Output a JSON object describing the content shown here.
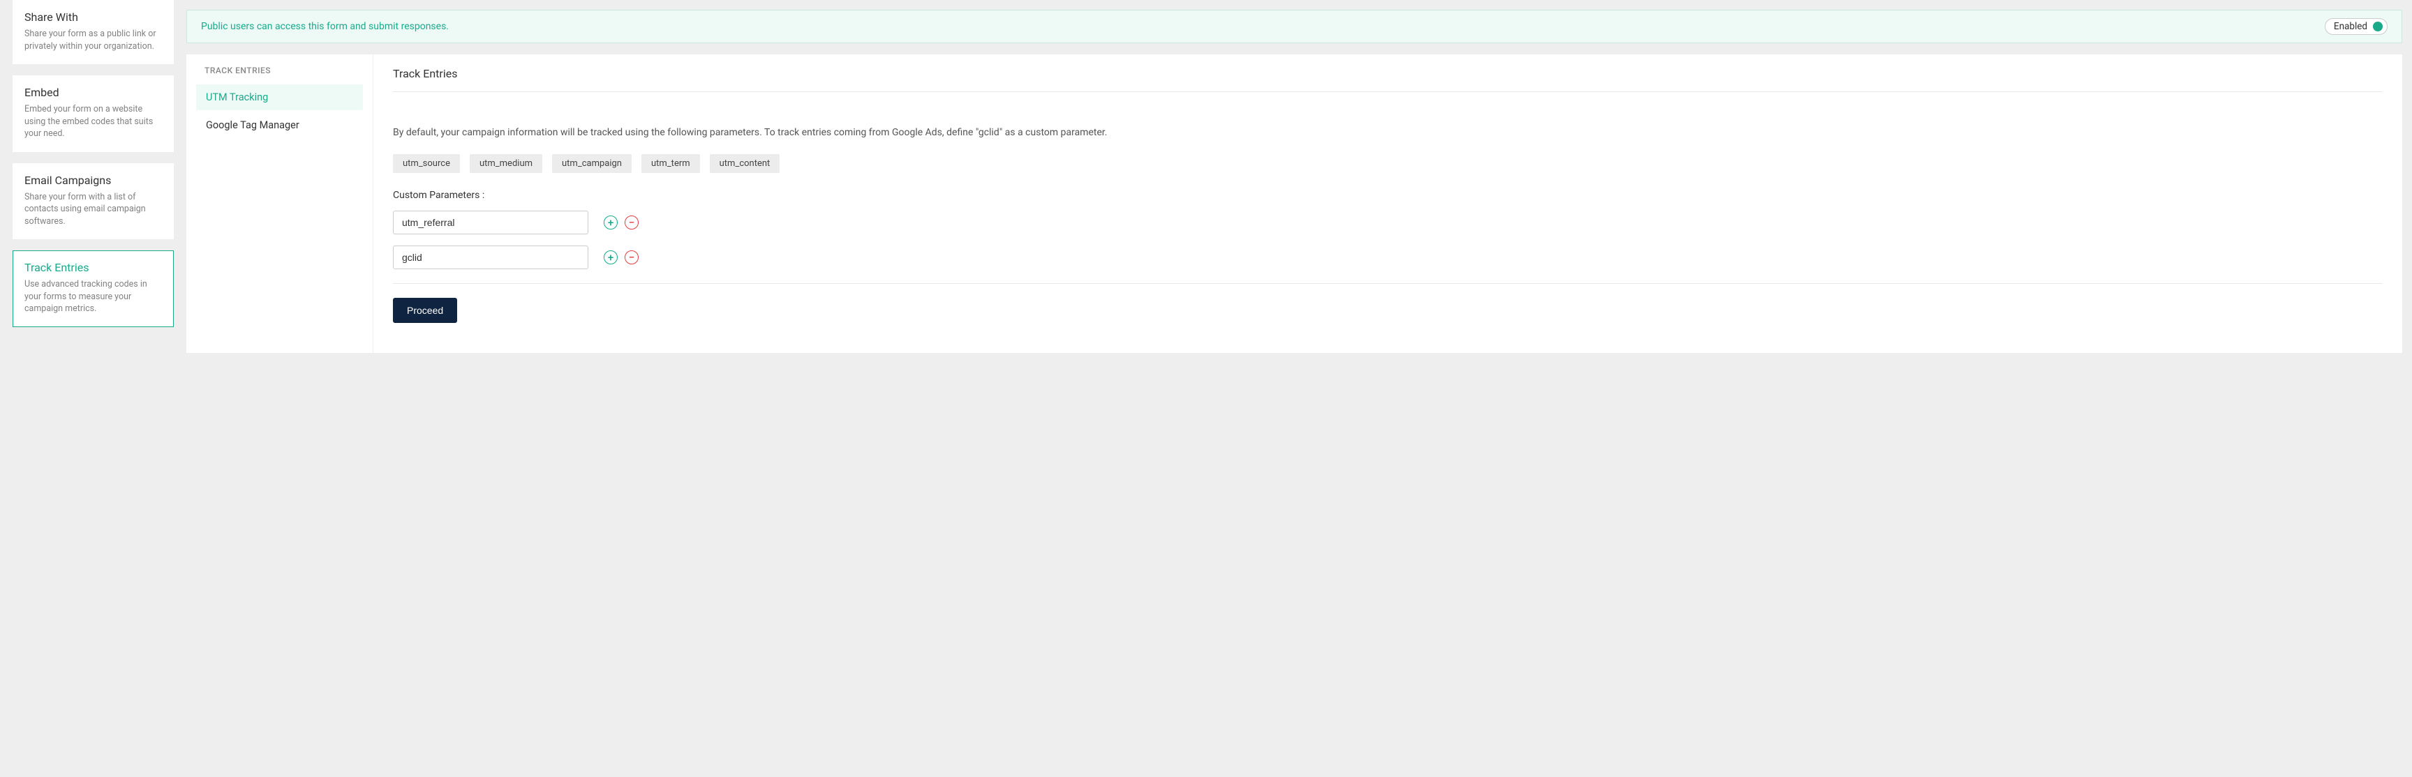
{
  "sidebar": {
    "items": [
      {
        "title": "Share With",
        "desc": "Share your form as a public link or privately within your organization.",
        "active": false
      },
      {
        "title": "Embed",
        "desc": "Embed your form on a website using the embed codes that suits your need.",
        "active": false
      },
      {
        "title": "Email Campaigns",
        "desc": "Share your form with a list of contacts using email campaign softwares.",
        "active": false
      },
      {
        "title": "Track Entries",
        "desc": "Use advanced tracking codes in your forms to measure your campaign metrics.",
        "active": true
      }
    ]
  },
  "banner": {
    "text": "Public users can access this form and submit responses.",
    "toggle_label": "Enabled"
  },
  "inner_sidebar": {
    "header": "TRACK ENTRIES",
    "items": [
      {
        "label": "UTM Tracking",
        "active": true
      },
      {
        "label": "Google Tag Manager",
        "active": false
      }
    ]
  },
  "content": {
    "title": "Track Entries",
    "desc": "By default, your campaign information will be tracked using the following parameters. To track entries coming from Google Ads, define \"gclid\" as a custom parameter.",
    "tags": [
      "utm_source",
      "utm_medium",
      "utm_campaign",
      "utm_term",
      "utm_content"
    ],
    "custom_params_label": "Custom Parameters :",
    "custom_params": [
      {
        "value": "utm_referral"
      },
      {
        "value": "gclid"
      }
    ],
    "proceed_label": "Proceed"
  }
}
